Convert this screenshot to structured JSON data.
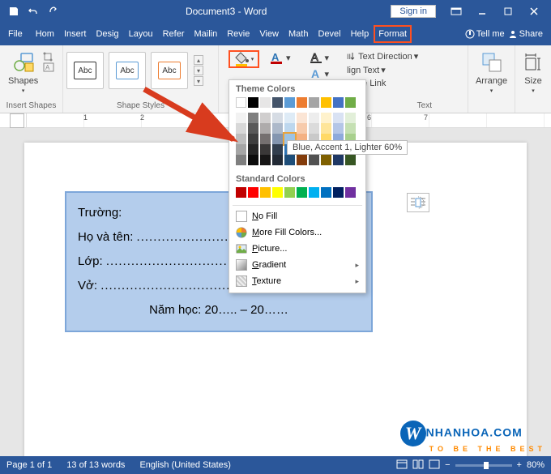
{
  "titlebar": {
    "doc": "Document3 - Word",
    "signin": "Sign in"
  },
  "tabs": {
    "file": "File",
    "home": "Hom",
    "insert": "Insert",
    "design": "Desig",
    "layout": "Layou",
    "references": "Refer",
    "mailings": "Mailin",
    "review": "Revie",
    "view": "View",
    "math": "Math",
    "developer": "Devel",
    "help": "Help",
    "format": "Format",
    "tellme": "Tell me",
    "share": "Share"
  },
  "ribbon": {
    "insertShapes": "Insert Shapes",
    "shapes": "Shapes",
    "abc": "Abc",
    "shapeStyles": "Shape Styles",
    "text": "Text",
    "arrange": "Arrange",
    "size": "Size",
    "textDirection": "Text Direction",
    "alignText": "lign Text",
    "createLink": "reate Link"
  },
  "dropdown": {
    "themeColors": "Theme Colors",
    "standardColors": "Standard Colors",
    "noFill": "No Fill",
    "moreFill": "More Fill Colors...",
    "picture": "Picture...",
    "gradient": "Gradient",
    "texture": "Texture",
    "tooltip": "Blue, Accent 1, Lighter 60%",
    "themeRow1": [
      "#ffffff",
      "#000000",
      "#e7e6e6",
      "#44546a",
      "#5b9bd5",
      "#ed7d31",
      "#a5a5a5",
      "#ffc000",
      "#4472c4",
      "#70ad47"
    ],
    "themeTints": [
      [
        "#f2f2f2",
        "#7f7f7f",
        "#d0cece",
        "#d6dce4",
        "#deebf6",
        "#fbe5d5",
        "#ededed",
        "#fff2cc",
        "#d9e2f3",
        "#e2efd9"
      ],
      [
        "#d8d8d8",
        "#595959",
        "#aeabab",
        "#adb9ca",
        "#bdd7ee",
        "#f7cbac",
        "#dbdbdb",
        "#fee599",
        "#b4c6e7",
        "#c5e0b3"
      ],
      [
        "#bfbfbf",
        "#3f3f3f",
        "#757070",
        "#8496b0",
        "#9cc3e5",
        "#f4b183",
        "#c9c9c9",
        "#ffd965",
        "#8eaadb",
        "#a8d08d"
      ],
      [
        "#a5a5a5",
        "#262626",
        "#3a3838",
        "#323f4f",
        "#2e75b5",
        "#c55a11",
        "#7b7b7b",
        "#bf9000",
        "#2f5496",
        "#538135"
      ],
      [
        "#7f7f7f",
        "#0c0c0c",
        "#171616",
        "#222a35",
        "#1e4e79",
        "#833c0b",
        "#525252",
        "#7f6000",
        "#1f3864",
        "#375623"
      ]
    ],
    "standard": [
      "#c00000",
      "#ff0000",
      "#ffc000",
      "#ffff00",
      "#92d050",
      "#00b050",
      "#00b0f0",
      "#0070c0",
      "#002060",
      "#7030a0"
    ],
    "selectedIndex": {
      "row": 2,
      "col": 4
    }
  },
  "doc": {
    "truong": "Trường:",
    "hoten": "Họ và tên:",
    "lop": "Lớp:",
    "vo": "Vở:",
    "namhoc": "Năm học: 20….. – 20……"
  },
  "status": {
    "page": "Page 1 of 1",
    "words": "13 of 13 words",
    "lang": "English (United States)",
    "zoom": "80%"
  },
  "brand": {
    "main": "NHANHOA.COM",
    "sub": "TO BE THE BEST"
  }
}
